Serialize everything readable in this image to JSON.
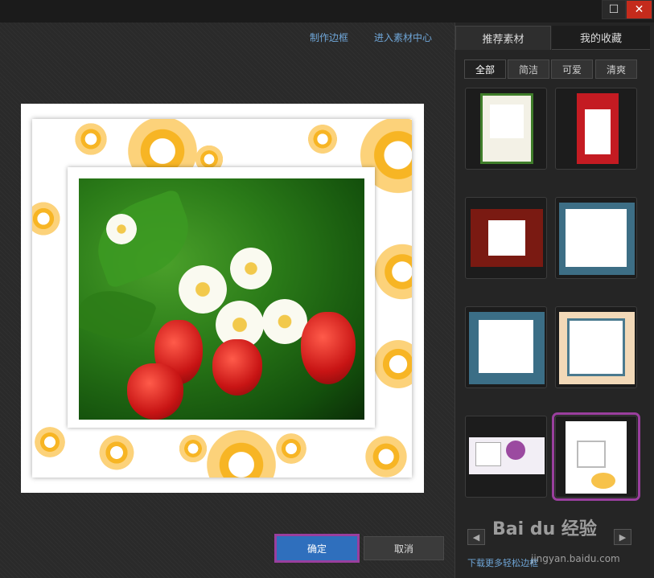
{
  "window": {
    "maximize_icon": "maximize-icon",
    "close_icon": "close-icon"
  },
  "main": {
    "links": {
      "make_border": "制作边框",
      "enter_material_center": "进入素材中心"
    },
    "buttons": {
      "confirm": "确定",
      "cancel": "取消"
    }
  },
  "sidebar": {
    "tabs": [
      "推荐素材",
      "我的收藏"
    ],
    "filters": [
      "全部",
      "简洁",
      "可爱",
      "清爽"
    ],
    "download_more": "下载更多轻松边框",
    "nav": {
      "prev_icon": "chevron-left-icon",
      "next_icon": "chevron-right-icon"
    }
  },
  "watermark": {
    "brand": "Bai du 经验",
    "url": "jingyan.baidu.com"
  },
  "colors": {
    "accent_link": "#6fa6d8",
    "confirm_button": "#2f6fbd",
    "selection_outline": "#9a3f9e",
    "close_button": "#c42b1c"
  }
}
